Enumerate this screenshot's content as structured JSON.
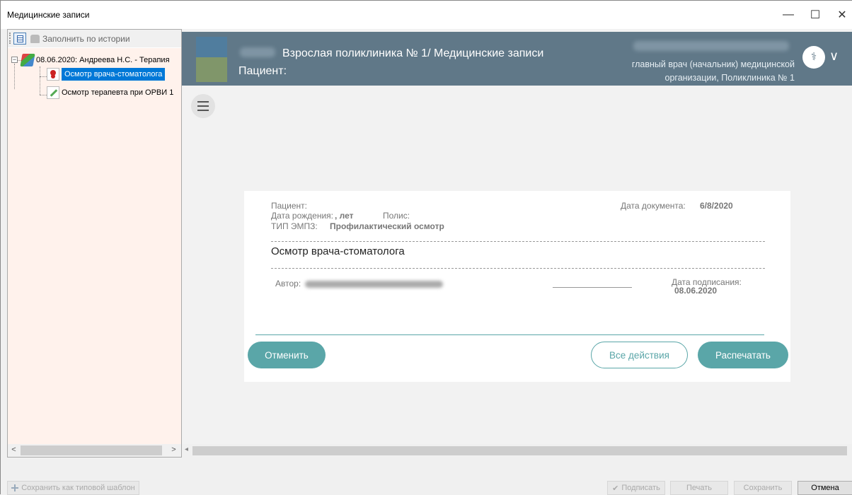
{
  "window": {
    "title": "Медицинские записи",
    "minimize": "—",
    "maximize": "☐",
    "close": "✕"
  },
  "left_panel": {
    "fill_history": "Заполнить по истории",
    "tree": {
      "root": "08.06.2020: Андреева Н.С. - Терапия",
      "children": [
        "Осмотр врача-стоматолога",
        "Осмотр терапевта при ОРВИ 1"
      ],
      "selected_index": 0
    }
  },
  "header": {
    "clinic": "Взрослая поликлиника № 1/ Медицинские записи",
    "patient": "Пациент:",
    "doctor_role": "главный врач (начальник) медицинской организации, Поликлиника № 1",
    "menu_icon": "chevron-down-icon"
  },
  "document": {
    "patient_label": "Пациент:",
    "birth_label": "Дата рождения:",
    "age_value": ", лет",
    "policy_label": "Полис:",
    "emz_label": "ТИП ЭМПЗ:",
    "emz_value": "Профилактический осмотр",
    "doc_date_label": "Дата документа:",
    "doc_date_value": "6/8/2020",
    "title": "Осмотр врача-стоматолога",
    "author_label": "Автор:",
    "sign_date_label": "Дата подписания:",
    "sign_date_value": "08.06.2020"
  },
  "actions": {
    "cancel": "Отменить",
    "all": "Все действия",
    "print": "Распечатать"
  },
  "bottom": {
    "save_template": "Сохранить как типовой шаблон",
    "sign": "Подписать",
    "print": "Печать",
    "save": "Сохранить",
    "cancel": "Отмена"
  },
  "colors": {
    "header": "#607888",
    "accent": "#5aa6a8",
    "selection": "#0078d7",
    "tree_bg": "#fff2ec"
  }
}
